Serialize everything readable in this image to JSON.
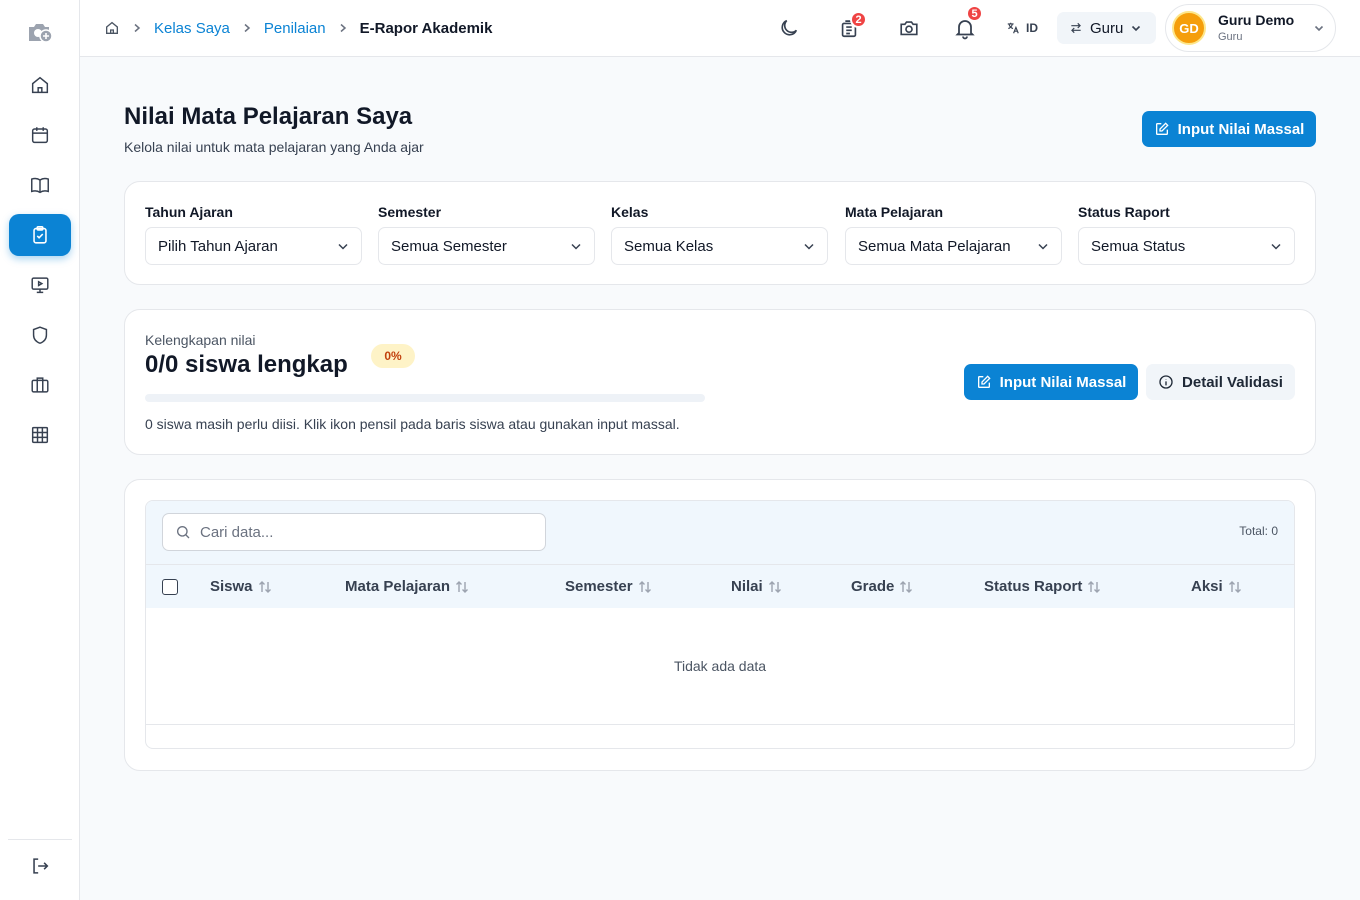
{
  "breadcrumb": {
    "items": [
      "Kelas Saya",
      "Penilaian"
    ],
    "current": "E-Rapor Akademik"
  },
  "topbar": {
    "notes_badge": "2",
    "notif_badge": "5",
    "language": "ID",
    "role_switch": "Guru",
    "user": {
      "initials": "GD",
      "name": "Guru Demo",
      "role": "Guru"
    }
  },
  "sidebar": {
    "items": [
      "home-icon",
      "calendar-icon",
      "book-icon",
      "clipboard-check-icon",
      "presentation-icon",
      "shield-icon",
      "briefcase-icon",
      "grid-icon"
    ],
    "active_index": 3,
    "active_color": "#0b83d4"
  },
  "page": {
    "title": "Nilai Mata Pelajaran Saya",
    "subtitle": "Kelola nilai untuk mata pelajaran yang Anda ajar",
    "primary_action": "Input Nilai Massal"
  },
  "filters": [
    {
      "label": "Tahun Ajaran",
      "value": "Pilih Tahun Ajaran"
    },
    {
      "label": "Semester",
      "value": "Semua Semester"
    },
    {
      "label": "Kelas",
      "value": "Semua Kelas"
    },
    {
      "label": "Mata Pelajaran",
      "value": "Semua Mata Pelajaran"
    },
    {
      "label": "Status Raport",
      "value": "Semua Status"
    }
  ],
  "progress": {
    "label": "Kelengkapan nilai",
    "title": "0/0 siswa lengkap",
    "percent_label": "0%",
    "percent": 0,
    "description": "0 siswa masih perlu diisi. Klik ikon pensil pada baris siswa atau gunakan input massal.",
    "primary_button": "Input Nilai Massal",
    "secondary_button": "Detail Validasi"
  },
  "table": {
    "search_placeholder": "Cari data...",
    "total": "Total: 0",
    "columns": [
      "Siswa",
      "Mata Pelajaran",
      "Semester",
      "Nilai",
      "Grade",
      "Status Raport",
      "Aksi"
    ],
    "empty_text": "Tidak ada data"
  },
  "colors": {
    "primary": "#0b83d4",
    "badge": "#ef4444",
    "avatar": "#f59e0b"
  }
}
